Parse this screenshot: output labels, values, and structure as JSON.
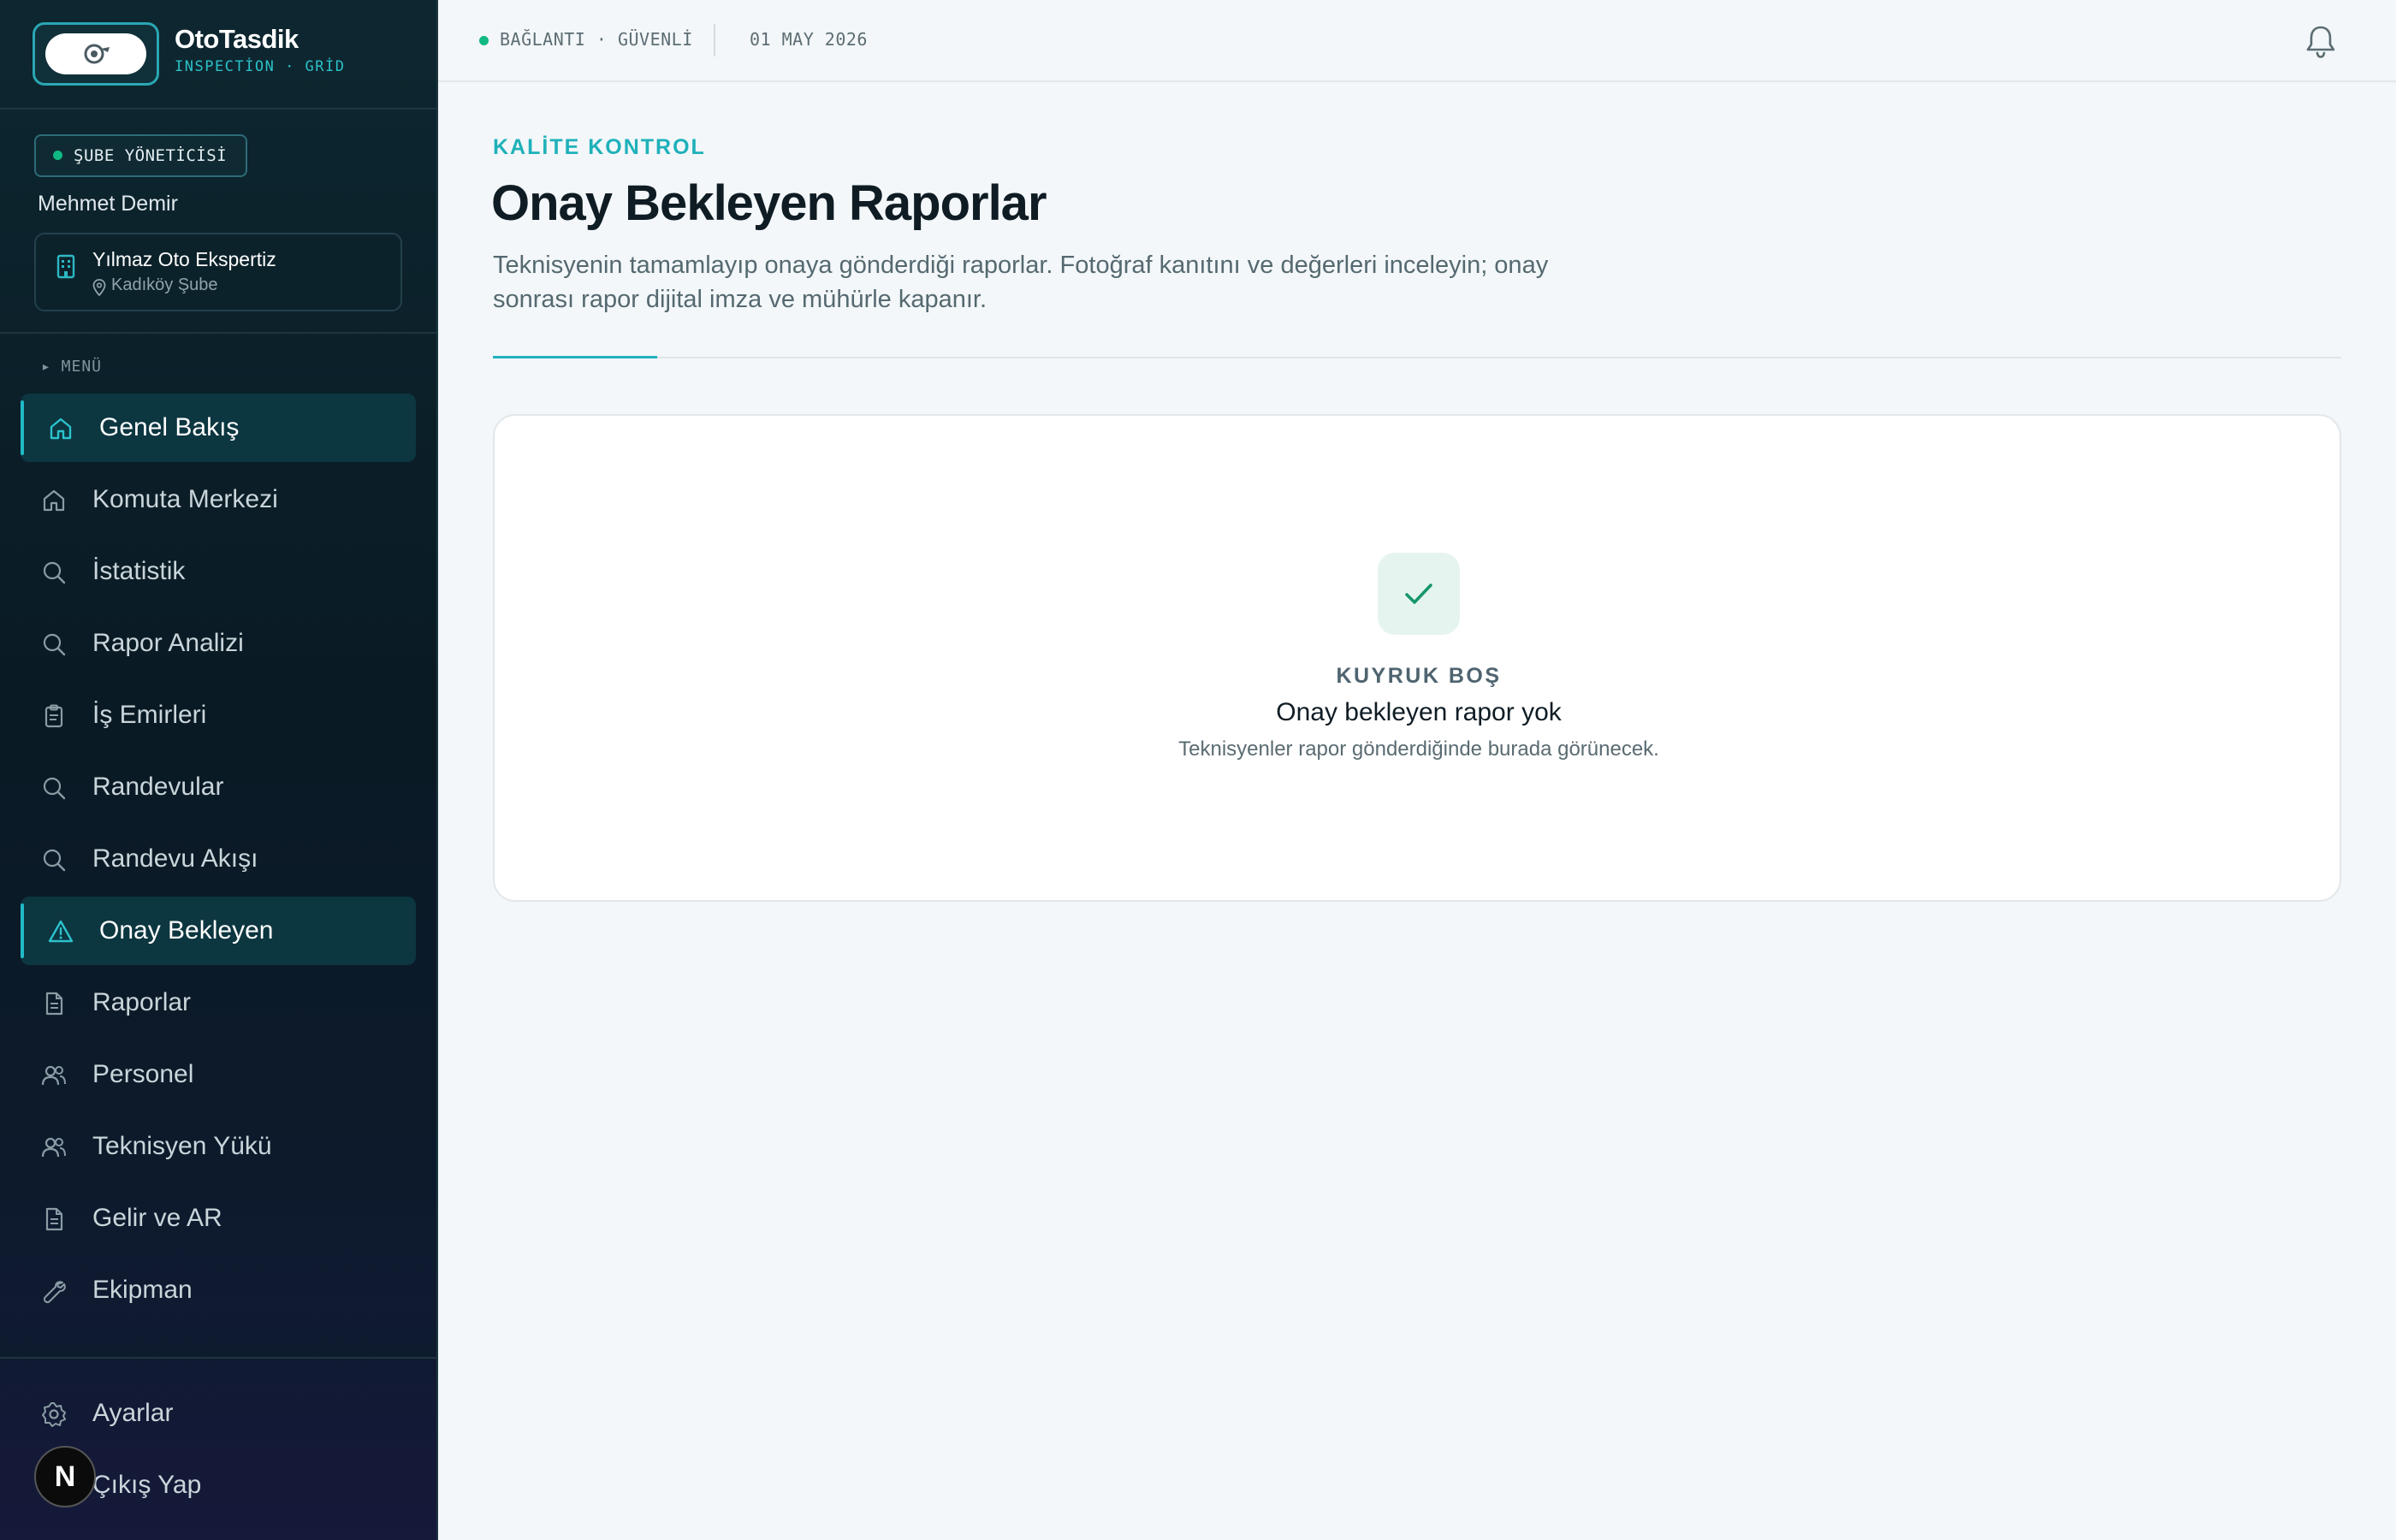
{
  "brand": {
    "title": "OtoTasdik",
    "subtitle": "INSPECTİON · GRİD"
  },
  "user": {
    "role": "ŞUBE YÖNETİCİSİ",
    "name": "Mehmet Demir"
  },
  "branch": {
    "name": "Yılmaz Oto Ekspertiz",
    "location": "Kadıköy Şube"
  },
  "menu_label": "▸ MENÜ",
  "nav": [
    {
      "label": "Genel Bakış",
      "icon": "home-icon",
      "active": true
    },
    {
      "label": "Komuta Merkezi",
      "icon": "home-icon",
      "active": false
    },
    {
      "label": "İstatistik",
      "icon": "search-icon",
      "active": false
    },
    {
      "label": "Rapor Analizi",
      "icon": "search-icon",
      "active": false
    },
    {
      "label": "İş Emirleri",
      "icon": "clipboard-icon",
      "active": false
    },
    {
      "label": "Randevular",
      "icon": "search-icon",
      "active": false
    },
    {
      "label": "Randevu Akışı",
      "icon": "search-icon",
      "active": false
    },
    {
      "label": "Onay Bekleyen",
      "icon": "warning-icon",
      "active": true
    },
    {
      "label": "Raporlar",
      "icon": "document-icon",
      "active": false
    },
    {
      "label": "Personel",
      "icon": "users-icon",
      "active": false
    },
    {
      "label": "Teknisyen Yükü",
      "icon": "users-icon",
      "active": false
    },
    {
      "label": "Gelir ve AR",
      "icon": "document-icon",
      "active": false
    },
    {
      "label": "Ekipman",
      "icon": "wrench-icon",
      "active": false
    }
  ],
  "bottom_nav": [
    {
      "label": "Ayarlar",
      "icon": "gear-icon"
    },
    {
      "label": "Çıkış Yap",
      "icon": "logout-icon"
    }
  ],
  "avatar_letter": "N",
  "topbar": {
    "connection": "BAĞLANTI · GÜVENLİ",
    "date": "01 MAY 2026"
  },
  "page": {
    "eyebrow": "KALİTE KONTROL",
    "title": "Onay Bekleyen Raporlar",
    "description": "Teknisyenin tamamlayıp onaya gönderdiği raporlar. Fotoğraf kanıtını ve değerleri inceleyin; onay sonrası rapor dijital imza ve mühürle kapanır."
  },
  "empty_state": {
    "tag": "KUYRUK BOŞ",
    "title": "Onay bekleyen rapor yok",
    "subtitle": "Teknisyenler rapor gönderdiğinde burada görünecek."
  },
  "colors": {
    "accent": "#21b9c6",
    "online": "#10b981",
    "sidebar": "#0a1a24",
    "check": "#15976b"
  }
}
